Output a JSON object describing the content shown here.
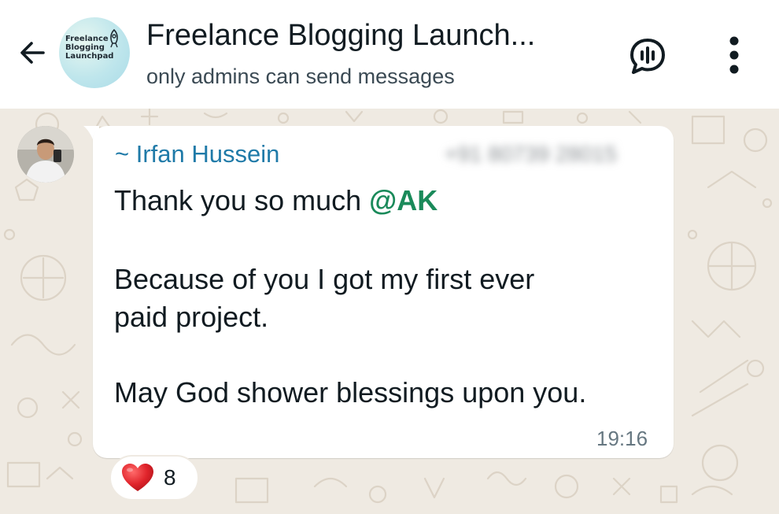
{
  "header": {
    "title": "Freelance Blogging Launch...",
    "subtitle": "only admins can send messages",
    "group_logo_lines": [
      "Freelance",
      "Blogging",
      "Launchpad"
    ],
    "back_icon": "arrow-left-icon",
    "voice_chat_icon": "voice-chat-icon",
    "menu_icon": "more-vertical-icon"
  },
  "message": {
    "sender_prefix": "~ ",
    "sender_name": "Irfan Hussein",
    "sender_phone": "+91 80739 28015",
    "line1_text": "Thank you so much ",
    "mention": "@AK",
    "line2": "Because of you I got my first ever",
    "line3": "paid project.",
    "line4": "May God shower blessings upon you.",
    "time": "19:16",
    "reaction_emoji": "heart-icon",
    "reaction_count": "8"
  },
  "colors": {
    "chat_background": "#efeae2",
    "sender_name": "#1f7aa8",
    "mention": "#1a8a5a",
    "heart": "#e0242b"
  }
}
